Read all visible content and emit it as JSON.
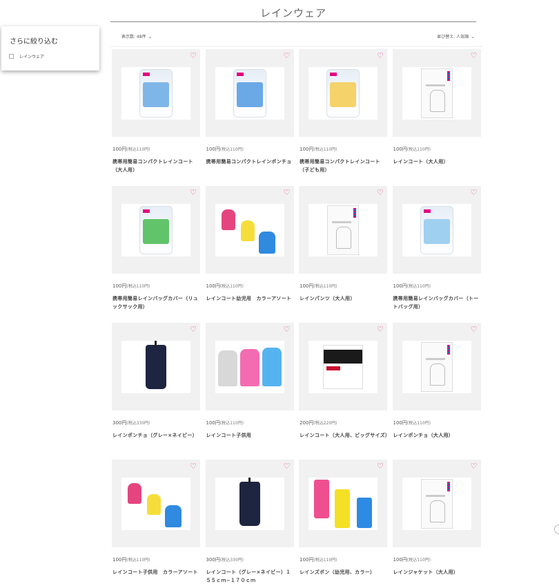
{
  "page": {
    "title": "レインウェア"
  },
  "filter": {
    "title": "さらに絞り込む",
    "option_label": "レインウェア"
  },
  "toolbar": {
    "count_label": "表示数: 48件",
    "sort_label": "並び替え: 人気順"
  },
  "colors": {
    "accent": "#e23a8f",
    "heart": "#e23a8f"
  },
  "products": [
    {
      "price": "100円",
      "tax": "(税込110円)",
      "name": "携帯用簡易コンパクトレインコート（大人用）",
      "image": "pouch-blue"
    },
    {
      "price": "100円",
      "tax": "(税込110円)",
      "name": "携帯用簡易コンパクトレインポンチョ",
      "image": "pouch-blue2"
    },
    {
      "price": "100円",
      "tax": "(税込110円)",
      "name": "携帯用簡易コンパクトレインコート（子ども用）",
      "image": "pouch-yellow"
    },
    {
      "price": "100円",
      "tax": "(税込110円)",
      "name": "レインコート（大人用）",
      "image": "booklet-raincoat"
    },
    {
      "price": "100円",
      "tax": "(税込110円)",
      "name": "携帯用簡易レインバッグカバー（リュックサック用）",
      "image": "pouch-green"
    },
    {
      "price": "100円",
      "tax": "(税込110円)",
      "name": "レインコート幼児用　カラーアソート",
      "image": "kids-coats"
    },
    {
      "price": "100円",
      "tax": "(税込110円)",
      "name": "レインパンツ（大人用）",
      "image": "booklet-pants"
    },
    {
      "price": "100円",
      "tax": "(税込110円)",
      "name": "携帯用簡易レインバッグカバー（トートバッグ用）",
      "image": "pouch-tote"
    },
    {
      "price": "300円",
      "tax": "(税込330円)",
      "name": "レインポンチョ（グレー×ネイビー）",
      "image": "navy-bag"
    },
    {
      "price": "100円",
      "tax": "(税込110円)",
      "name": "レインコート子供用",
      "image": "kids-coats-clear"
    },
    {
      "price": "200円",
      "tax": "(税込220円)",
      "name": "レインコート（大人用、ビッグサイズ）",
      "image": "bw-pack"
    },
    {
      "price": "100円",
      "tax": "(税込110円)",
      "name": "レインポンチョ（大人用）",
      "image": "booklet-poncho"
    },
    {
      "price": "100円",
      "tax": "(税込110円)",
      "name": "レインコート子供用　カラーアソート",
      "image": "kids-coats"
    },
    {
      "price": "300円",
      "tax": "(税込330円)",
      "name": "レインコート（グレー×ネイビー）１５５ｃｍ−１７０ｃｍ",
      "image": "navy-bag"
    },
    {
      "price": "100円",
      "tax": "(税込110円)",
      "name": "レインズボン（幼児用、カラー）",
      "image": "kids-pants"
    },
    {
      "price": "100円",
      "tax": "(税込110円)",
      "name": "レインジャケット（大人用）",
      "image": "booklet-jacket"
    }
  ]
}
